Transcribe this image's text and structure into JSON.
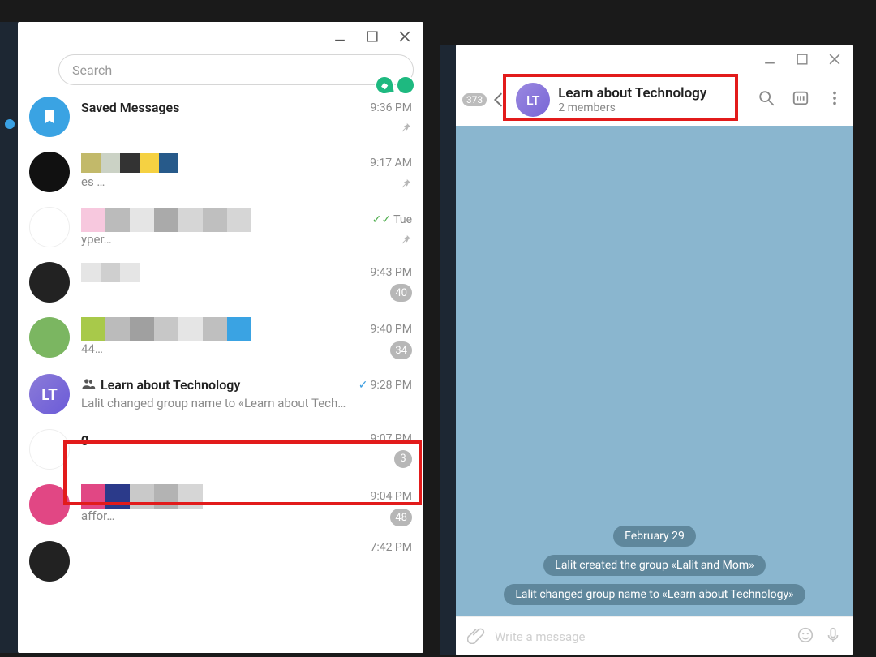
{
  "left": {
    "search_placeholder": "Search",
    "items": [
      {
        "name": "Saved Messages",
        "time": "9:36 PM",
        "line2": "",
        "meta": "pin"
      },
      {
        "name": "",
        "time": "9:17 AM",
        "line2": "es …",
        "meta": "pin"
      },
      {
        "name": "",
        "time": "Tue",
        "line2": "yper…",
        "meta": "pin",
        "tick": "double"
      },
      {
        "name": "",
        "time": "9:43 PM",
        "line2": "",
        "meta": "40"
      },
      {
        "name": "",
        "time": "9:40 PM",
        "line2": "44…",
        "meta": "34"
      },
      {
        "name": "Learn about Technology",
        "time": "9:28 PM",
        "line2": "Lalit changed group name to «Learn about Tech…",
        "meta": "",
        "tick": "single",
        "group": true,
        "avatar": "LT"
      },
      {
        "name": "g…",
        "time": "9:07 PM",
        "line2": "",
        "meta": "3"
      },
      {
        "name": "",
        "time": "9:04 PM",
        "line2": "affor…",
        "meta": "48"
      },
      {
        "name": "",
        "time": "7:42 PM",
        "line2": "",
        "meta": ""
      }
    ]
  },
  "right": {
    "back_badge": "373",
    "avatar": "LT",
    "title": "Learn about Technology",
    "subtitle": "2 members",
    "date_pill": "February 29",
    "sys1": "Lalit created the group «Lalit and Mom»",
    "sys2": "Lalit changed group name to «Learn about Technology»",
    "composer_placeholder": "Write a message"
  }
}
